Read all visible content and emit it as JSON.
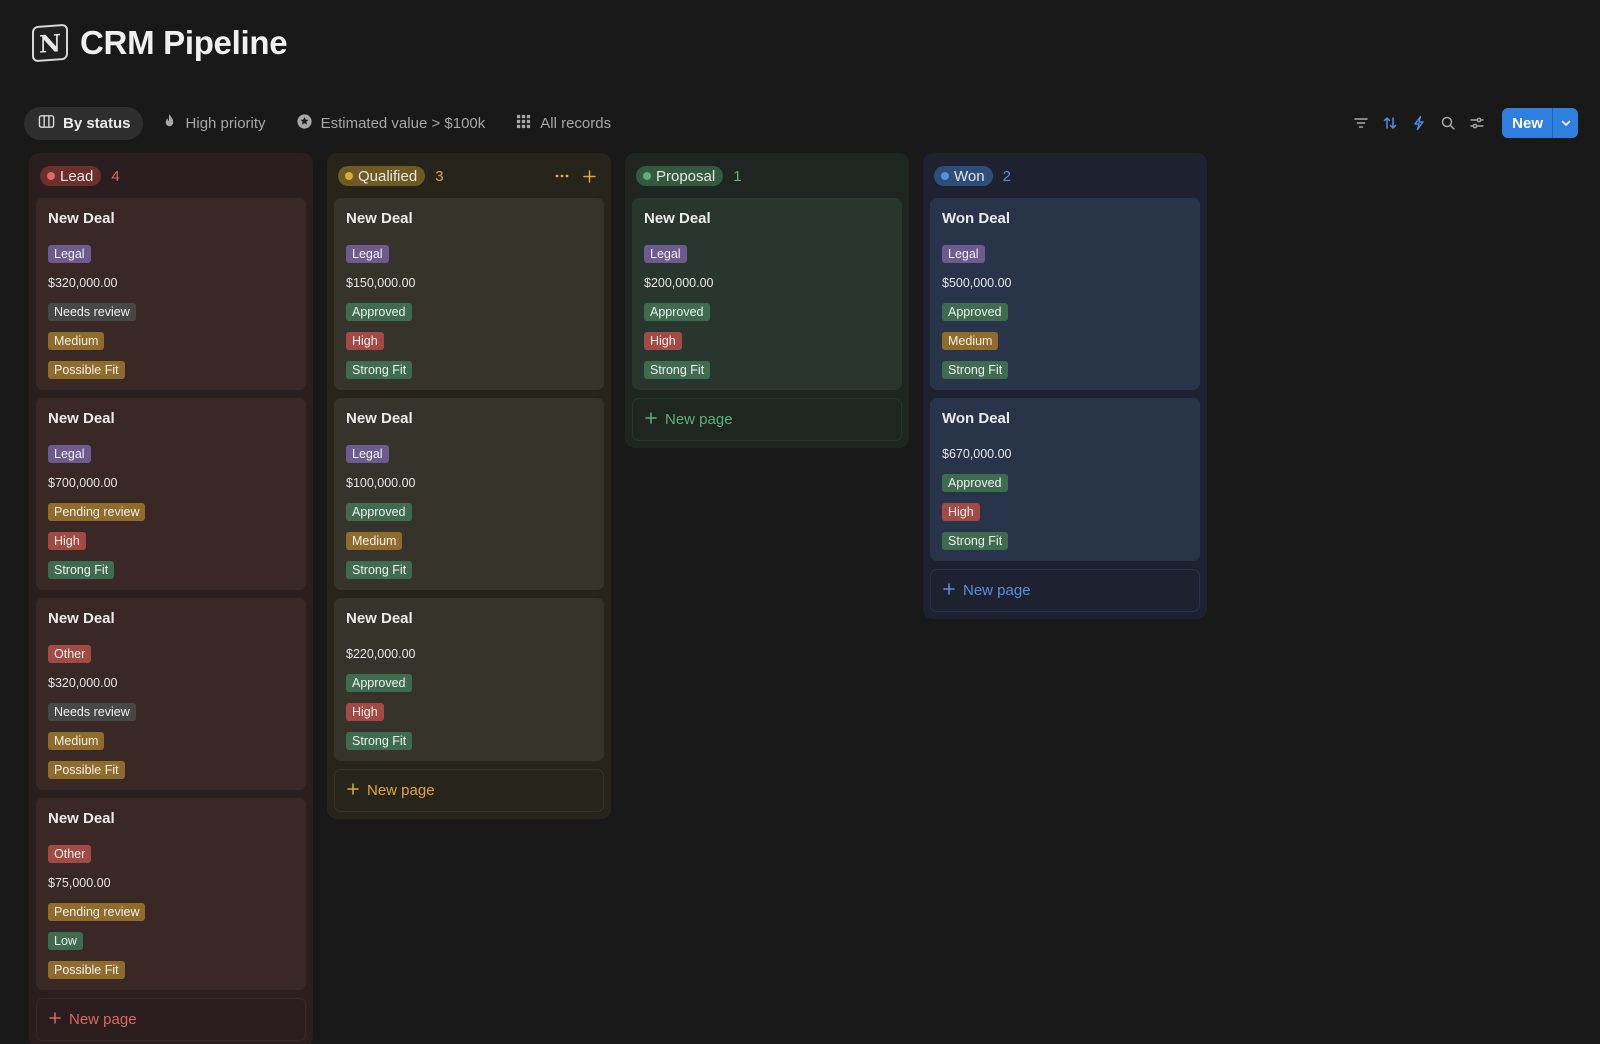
{
  "app": {
    "title": "CRM Pipeline",
    "logo_letter": "N"
  },
  "views": [
    {
      "label": "By status",
      "icon": "board-icon",
      "active": true
    },
    {
      "label": "High priority",
      "icon": "fire-icon",
      "active": false
    },
    {
      "label": "Estimated value > $100k",
      "icon": "star-badge-icon",
      "active": false
    },
    {
      "label": "All records",
      "icon": "grid-icon",
      "active": false
    }
  ],
  "tools": [
    "filter-icon",
    "sort-icon",
    "automation-icon",
    "search-icon",
    "settings-icon"
  ],
  "new_button": {
    "label": "New"
  },
  "colors": {
    "tag_legal": "#6d5a8e",
    "tag_other": "#a24a43",
    "tag_needs_review": "#474747",
    "tag_pending_review": "#8f6b2c",
    "tag_approved": "#3f6b4f",
    "tag_medium": "#8f6b2c",
    "tag_high": "#a24a43",
    "tag_low": "#3f6b4f",
    "tag_possible_fit": "#8f6b2c",
    "tag_strong_fit": "#3f6b4f",
    "accent_blue": "#2f7fe0"
  },
  "columns": [
    {
      "id": "lead",
      "name": "Lead",
      "count": "4",
      "bg": "#2a1f1e",
      "card_bg": "#3a2826",
      "pill_bg": "#6b2f2c",
      "dot": "#e0675f",
      "count_color": "#e0675f",
      "new_page_label": "New page",
      "cards": [
        {
          "title": "New Deal",
          "rows": [
            {
              "kind": "tag",
              "text": "Legal",
              "color": "tag_legal"
            },
            {
              "kind": "amount",
              "text": "$320,000.00"
            },
            {
              "kind": "tag",
              "text": "Needs review",
              "color": "tag_needs_review"
            },
            {
              "kind": "tag",
              "text": "Medium",
              "color": "tag_medium"
            },
            {
              "kind": "tag",
              "text": "Possible Fit",
              "color": "tag_possible_fit"
            }
          ]
        },
        {
          "title": "New Deal",
          "rows": [
            {
              "kind": "tag",
              "text": "Legal",
              "color": "tag_legal"
            },
            {
              "kind": "amount",
              "text": "$700,000.00"
            },
            {
              "kind": "tag",
              "text": "Pending review",
              "color": "tag_pending_review"
            },
            {
              "kind": "tag",
              "text": "High",
              "color": "tag_high"
            },
            {
              "kind": "tag",
              "text": "Strong Fit",
              "color": "tag_strong_fit"
            }
          ]
        },
        {
          "title": "New Deal",
          "rows": [
            {
              "kind": "tag",
              "text": "Other",
              "color": "tag_other"
            },
            {
              "kind": "amount",
              "text": "$320,000.00"
            },
            {
              "kind": "tag",
              "text": "Needs review",
              "color": "tag_needs_review"
            },
            {
              "kind": "tag",
              "text": "Medium",
              "color": "tag_medium"
            },
            {
              "kind": "tag",
              "text": "Possible Fit",
              "color": "tag_possible_fit"
            }
          ]
        },
        {
          "title": "New Deal",
          "rows": [
            {
              "kind": "tag",
              "text": "Other",
              "color": "tag_other"
            },
            {
              "kind": "amount",
              "text": "$75,000.00"
            },
            {
              "kind": "tag",
              "text": "Pending review",
              "color": "tag_pending_review"
            },
            {
              "kind": "tag",
              "text": "Low",
              "color": "tag_low"
            },
            {
              "kind": "tag",
              "text": "Possible Fit",
              "color": "tag_possible_fit"
            }
          ]
        }
      ]
    },
    {
      "id": "qualified",
      "name": "Qualified",
      "count": "3",
      "bg": "#26241b",
      "card_bg": "#36332a",
      "pill_bg": "#6e5a23",
      "dot": "#e0a83a",
      "count_color": "#e0a83a",
      "new_page_label": "New page",
      "show_actions": true,
      "cards": [
        {
          "title": "New Deal",
          "rows": [
            {
              "kind": "tag",
              "text": "Legal",
              "color": "tag_legal"
            },
            {
              "kind": "amount",
              "text": "$150,000.00"
            },
            {
              "kind": "tag",
              "text": "Approved",
              "color": "tag_approved"
            },
            {
              "kind": "tag",
              "text": "High",
              "color": "tag_high"
            },
            {
              "kind": "tag",
              "text": "Strong Fit",
              "color": "tag_strong_fit"
            }
          ]
        },
        {
          "title": "New Deal",
          "rows": [
            {
              "kind": "tag",
              "text": "Legal",
              "color": "tag_legal"
            },
            {
              "kind": "amount",
              "text": "$100,000.00"
            },
            {
              "kind": "tag",
              "text": "Approved",
              "color": "tag_approved"
            },
            {
              "kind": "tag",
              "text": "Medium",
              "color": "tag_medium"
            },
            {
              "kind": "tag",
              "text": "Strong Fit",
              "color": "tag_strong_fit"
            }
          ]
        },
        {
          "title": "New Deal",
          "rows": [
            {
              "kind": "amount",
              "text": "$220,000.00"
            },
            {
              "kind": "tag",
              "text": "Approved",
              "color": "tag_approved"
            },
            {
              "kind": "tag",
              "text": "High",
              "color": "tag_high"
            },
            {
              "kind": "tag",
              "text": "Strong Fit",
              "color": "tag_strong_fit"
            }
          ]
        }
      ]
    },
    {
      "id": "proposal",
      "name": "Proposal",
      "count": "1",
      "bg": "#1f2621",
      "card_bg": "#29362d",
      "pill_bg": "#345a3f",
      "dot": "#5fb07a",
      "count_color": "#5fb07a",
      "new_page_label": "New page",
      "cards": [
        {
          "title": "New Deal",
          "rows": [
            {
              "kind": "tag",
              "text": "Legal",
              "color": "tag_legal"
            },
            {
              "kind": "amount",
              "text": "$200,000.00"
            },
            {
              "kind": "tag",
              "text": "Approved",
              "color": "tag_approved"
            },
            {
              "kind": "tag",
              "text": "High",
              "color": "tag_high"
            },
            {
              "kind": "tag",
              "text": "Strong Fit",
              "color": "tag_strong_fit"
            }
          ]
        }
      ]
    },
    {
      "id": "won",
      "name": "Won",
      "count": "2",
      "bg": "#1e2230",
      "card_bg": "#28344a",
      "pill_bg": "#2e4e7a",
      "dot": "#5a8fdd",
      "count_color": "#5a8fdd",
      "new_page_label": "New page",
      "cards": [
        {
          "title": "Won Deal",
          "rows": [
            {
              "kind": "tag",
              "text": "Legal",
              "color": "tag_legal"
            },
            {
              "kind": "amount",
              "text": "$500,000.00"
            },
            {
              "kind": "tag",
              "text": "Approved",
              "color": "tag_approved"
            },
            {
              "kind": "tag",
              "text": "Medium",
              "color": "tag_medium"
            },
            {
              "kind": "tag",
              "text": "Strong Fit",
              "color": "tag_strong_fit"
            }
          ]
        },
        {
          "title": "Won Deal",
          "rows": [
            {
              "kind": "amount",
              "text": "$670,000.00"
            },
            {
              "kind": "tag",
              "text": "Approved",
              "color": "tag_approved"
            },
            {
              "kind": "tag",
              "text": "High",
              "color": "tag_high"
            },
            {
              "kind": "tag",
              "text": "Strong Fit",
              "color": "tag_strong_fit"
            }
          ]
        }
      ]
    }
  ]
}
